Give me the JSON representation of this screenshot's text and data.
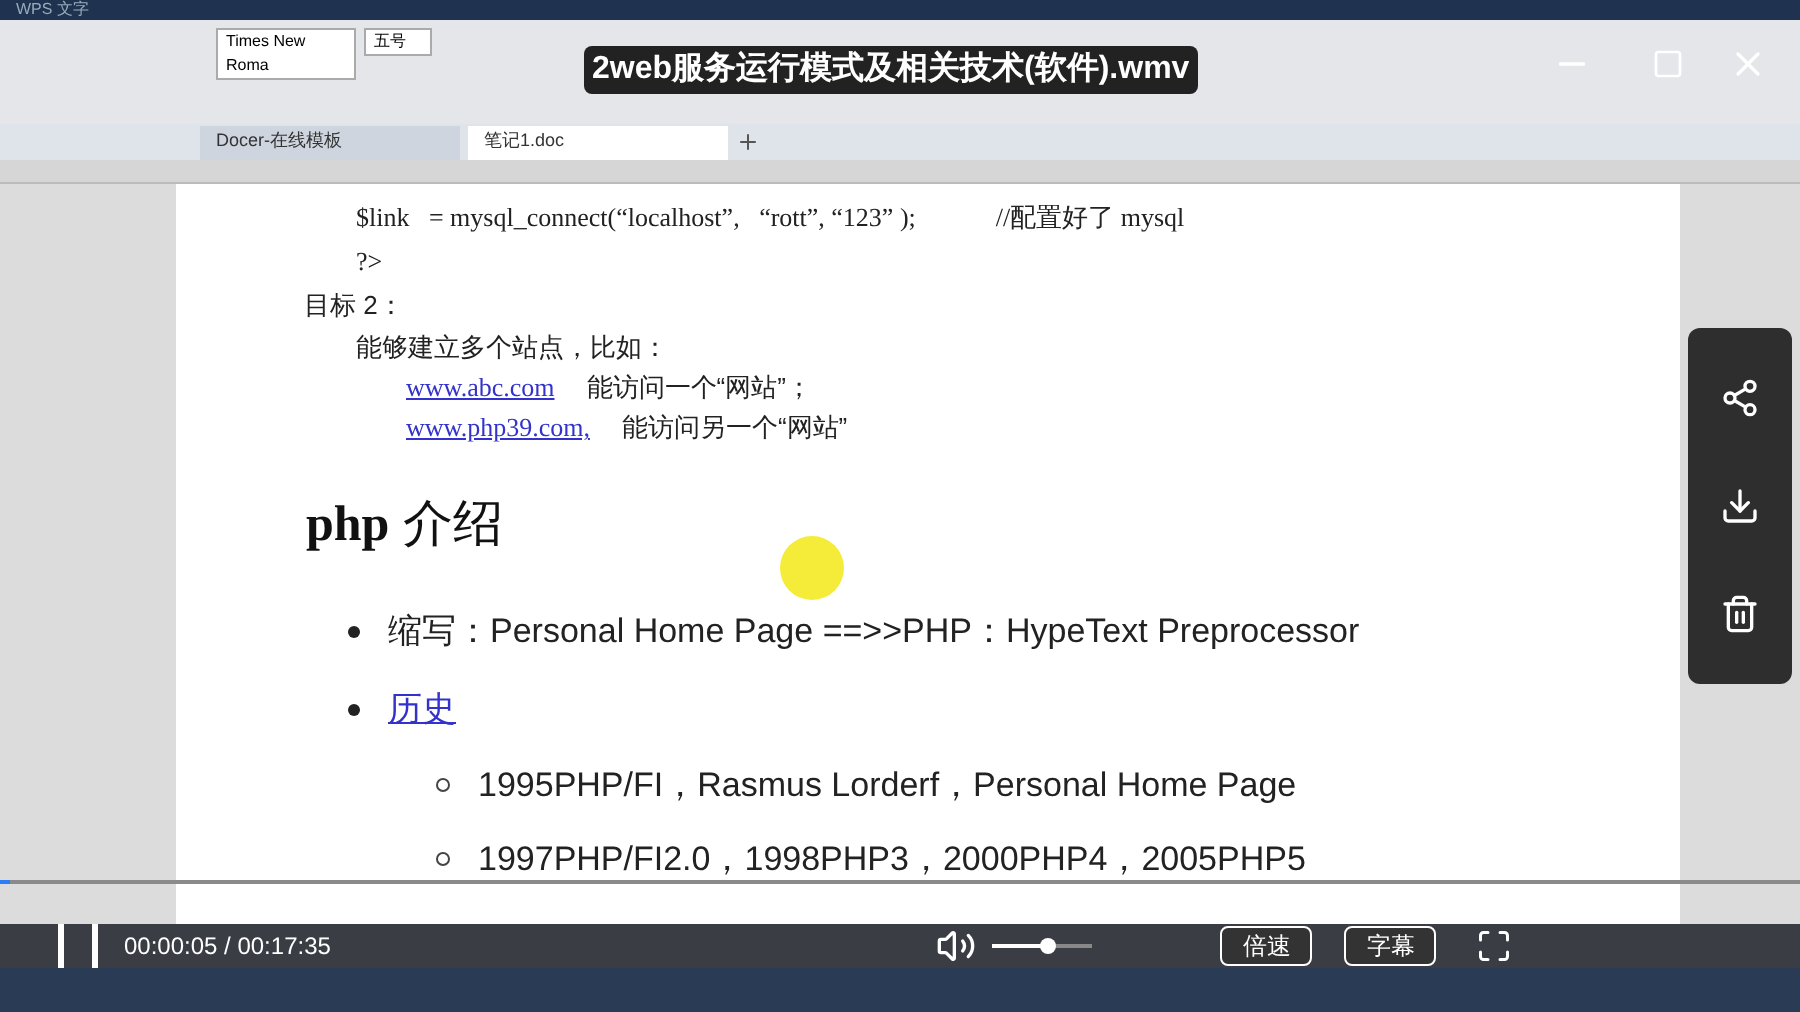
{
  "player": {
    "title": "2web服务运行模式及相关技术(软件).wmv",
    "time": "00:00:05 / 00:17:35",
    "progress": {
      "level": 0.005
    },
    "volume": {
      "level": 0.55
    },
    "speed_button": "倍速",
    "subtitle_button": "字幕"
  },
  "editor": {
    "app_name": "WPS 文字",
    "font_name": "Times New Roma",
    "font_size": "五号",
    "doc_tabs": [
      {
        "label": "Docer-在线模板",
        "selected": false
      },
      {
        "label": "笔记1.doc",
        "selected": true
      }
    ],
    "lines": [
      {
        "kind": "code",
        "text": "$link   = mysql_connect(“localhost”,   “rott”, “123” );",
        "comment": "//配置好了 mysql"
      },
      {
        "kind": "code",
        "text": "?>"
      },
      {
        "kind": "label",
        "text": "目标 2："
      },
      {
        "kind": "para",
        "text": "能够建立多个站点，比如："
      },
      {
        "kind": "link",
        "link": "www.abc.com",
        "text": "能访问一个“网站”；"
      },
      {
        "kind": "link",
        "link": "www.php39.com,",
        "text": "能访问另一个“网站”"
      },
      {
        "kind": "heading",
        "bold": "php",
        "text": "介绍"
      },
      {
        "kind": "bullet",
        "text": "缩写：Personal Home Page ==>>PHP：HypeText Preprocessor"
      },
      {
        "kind": "bullet_link",
        "text": "历史"
      },
      {
        "kind": "sub",
        "text": "1995PHP/FI，Rasmus Lorderf，Personal Home Page"
      },
      {
        "kind": "sub",
        "text": "1997PHP/FI2.0，1998PHP3，2000PHP4，2005PHP5"
      }
    ]
  }
}
